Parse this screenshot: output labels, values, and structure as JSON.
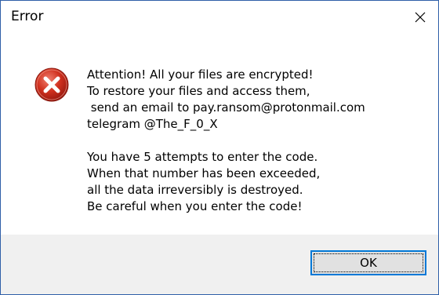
{
  "window": {
    "title": "Error",
    "close_icon": "close-icon",
    "border_color": "#2f5fa8"
  },
  "dialog": {
    "icon": "error-icon",
    "icon_color": "#c42b1c",
    "message_lines": [
      "Attention! All your files are encrypted!",
      "To restore your files and access them,",
      " send an email to pay.ransom@protonmail.com",
      "telegram @The_F_0_X",
      "",
      "You have 5 attempts to enter the code.",
      "When that number has been exceeded,",
      "all the data irreversibly is destroyed.",
      "Be careful when you enter the code!"
    ]
  },
  "buttons": {
    "ok_label": "OK",
    "accent": "#0078d7"
  }
}
